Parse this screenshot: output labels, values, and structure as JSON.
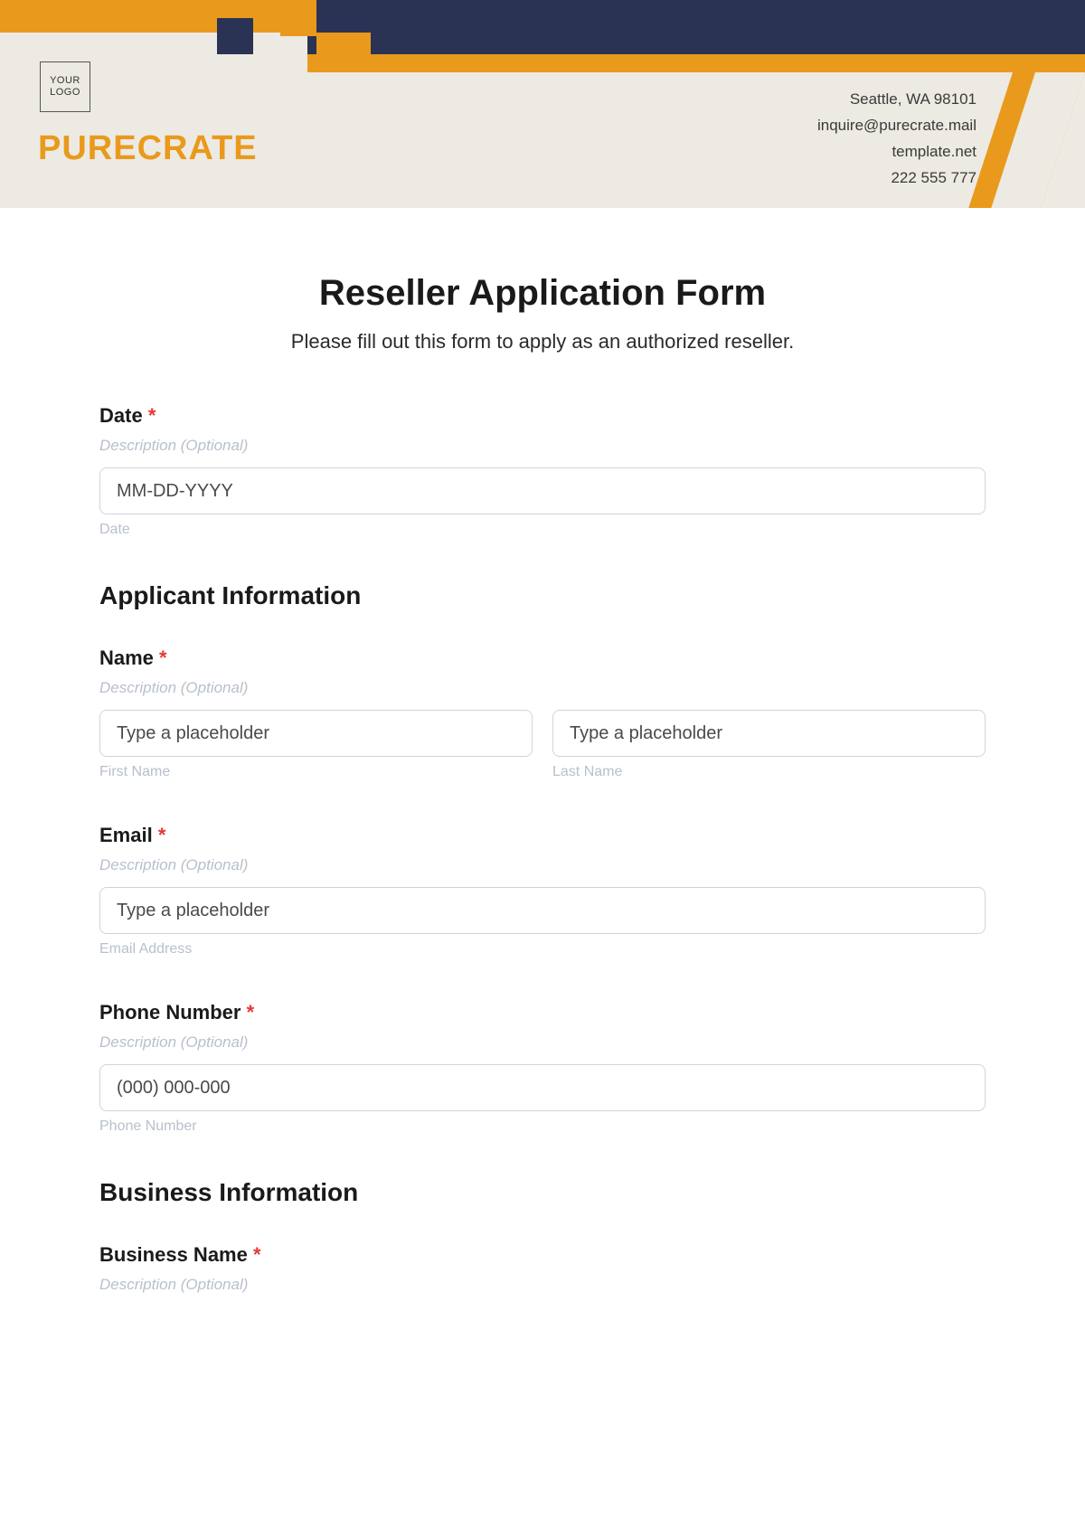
{
  "header": {
    "logo_text": "YOUR\nLOGO",
    "brand": "PURECRATE",
    "contact": {
      "address": "Seattle, WA 98101",
      "email": "inquire@purecrate.mail",
      "site": "template.net",
      "phone": "222 555 777"
    }
  },
  "form": {
    "title": "Reseller Application Form",
    "subtitle": "Please fill out this form to apply as an authorized reseller.",
    "desc_placeholder": "Description (Optional)",
    "required_mark": "*",
    "date": {
      "label": "Date",
      "placeholder": "MM-DD-YYYY",
      "sublabel": "Date"
    },
    "section_applicant": "Applicant Information",
    "name": {
      "label": "Name",
      "first_placeholder": "Type a placeholder",
      "last_placeholder": "Type a placeholder",
      "first_sub": "First Name",
      "last_sub": "Last Name"
    },
    "email": {
      "label": "Email",
      "placeholder": "Type a placeholder",
      "sublabel": "Email Address"
    },
    "phone": {
      "label": "Phone Number",
      "placeholder": "(000) 000-000",
      "sublabel": "Phone Number"
    },
    "section_business": "Business Information",
    "business_name": {
      "label": "Business Name"
    }
  }
}
